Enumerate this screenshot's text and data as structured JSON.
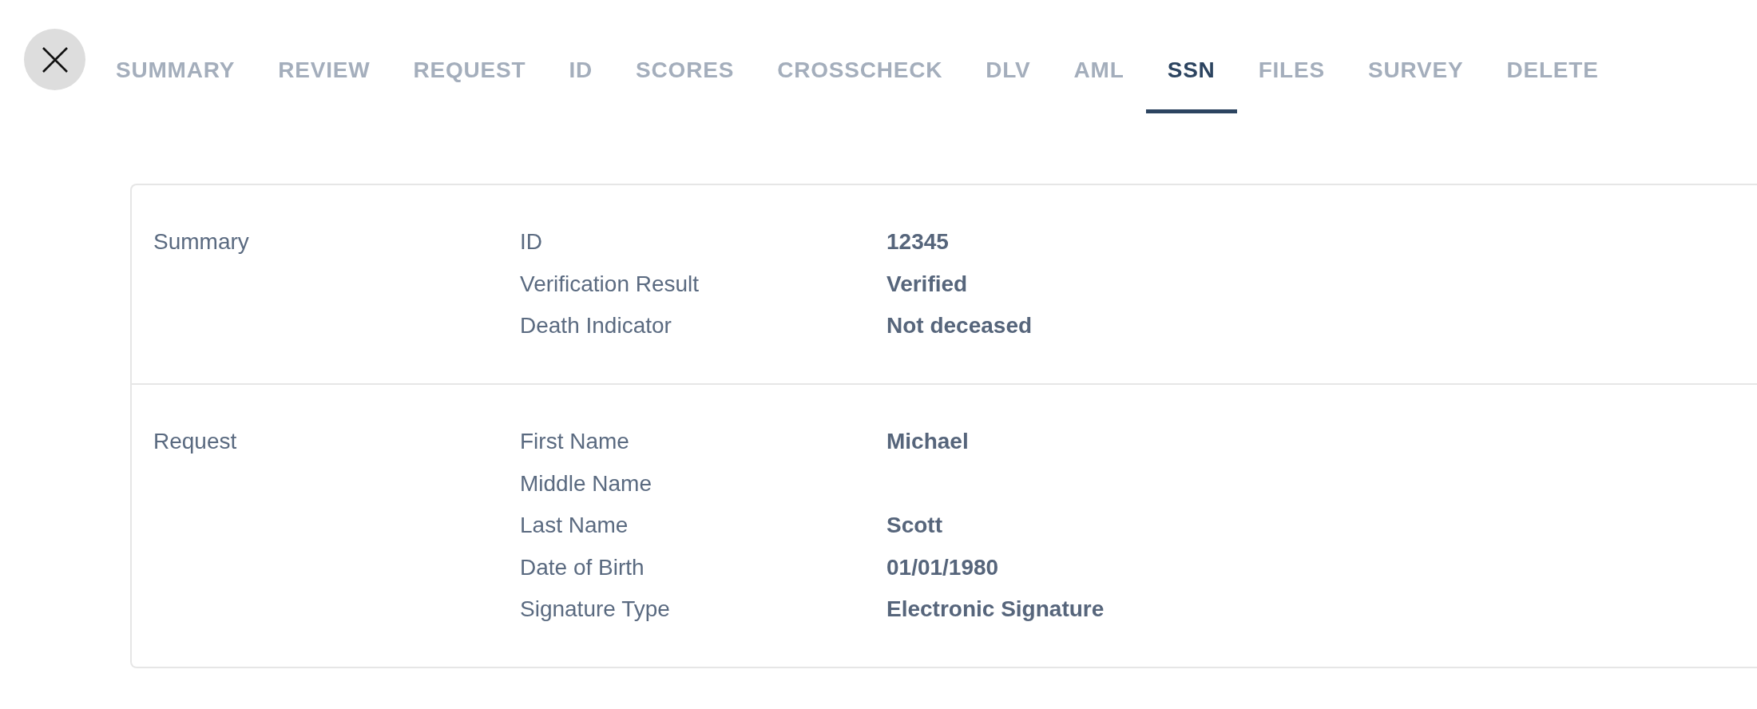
{
  "tabs": [
    {
      "label": "SUMMARY",
      "selected": false
    },
    {
      "label": "REVIEW",
      "selected": false
    },
    {
      "label": "REQUEST",
      "selected": false
    },
    {
      "label": "ID",
      "selected": false
    },
    {
      "label": "SCORES",
      "selected": false
    },
    {
      "label": "CROSSCHECK",
      "selected": false
    },
    {
      "label": "DLV",
      "selected": false
    },
    {
      "label": "AML",
      "selected": false
    },
    {
      "label": "SSN",
      "selected": true
    },
    {
      "label": "FILES",
      "selected": false
    },
    {
      "label": "SURVEY",
      "selected": false
    },
    {
      "label": "DELETE",
      "selected": false
    }
  ],
  "sections": [
    {
      "title": "Summary",
      "fields": [
        {
          "label": "ID",
          "value": "12345"
        },
        {
          "label": "Verification Result",
          "value": "Verified"
        },
        {
          "label": "Death Indicator",
          "value": "Not deceased"
        }
      ]
    },
    {
      "title": "Request",
      "fields": [
        {
          "label": "First Name",
          "value": "Michael"
        },
        {
          "label": "Middle Name"
        },
        {
          "label": "Last Name",
          "value": "Scott"
        },
        {
          "label": "Date of Birth",
          "value": "01/01/1980"
        },
        {
          "label": "Signature Type",
          "value": "Electronic Signature"
        }
      ]
    }
  ]
}
